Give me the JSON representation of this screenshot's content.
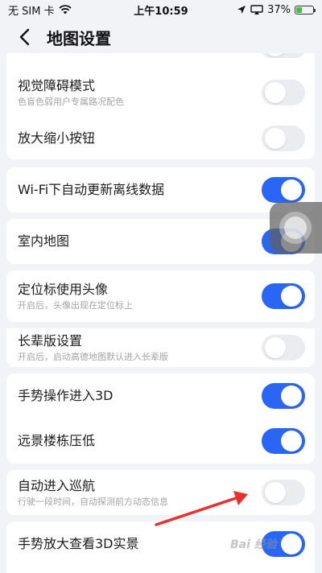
{
  "status_bar": {
    "carrier": "无 SIM 卡",
    "time": "上午10:59",
    "battery": "37%",
    "battery_level": 0.37
  },
  "header": {
    "title": "地图设置"
  },
  "settings": {
    "visual_impairment": {
      "label": "视觉障碍模式",
      "sub": "色盲色弱用户专属路况配色",
      "on": false
    },
    "zoom_buttons": {
      "label": "放大缩小按钮",
      "on": false
    },
    "wifi_update": {
      "label": "Wi-Fi下自动更新离线数据",
      "on": true
    },
    "indoor_map": {
      "label": "室内地图",
      "on": true
    },
    "avatar_marker": {
      "label": "定位标使用头像",
      "sub": "开启后，头像出现在定位标上",
      "on": true
    },
    "elder_mode": {
      "label": "长辈版设置",
      "sub": "开启后，启动高德地图默认进入长辈版",
      "on": false
    },
    "gesture_3d": {
      "label": "手势操作进入3D",
      "on": true
    },
    "lower_buildings": {
      "label": "远景楼栋压低",
      "on": true
    },
    "auto_cruise": {
      "label": "自动进入巡航",
      "sub": "行驶一段时间，自动探测前方动态信息",
      "on": false
    },
    "gesture_zoom_3d": {
      "label": "手势放大查看3D实景",
      "on": true
    }
  },
  "colors": {
    "toggle_on": "#2a66f6",
    "toggle_off": "#ebecf0",
    "arrow": "#e8312f"
  },
  "watermark": "Bai 经验"
}
